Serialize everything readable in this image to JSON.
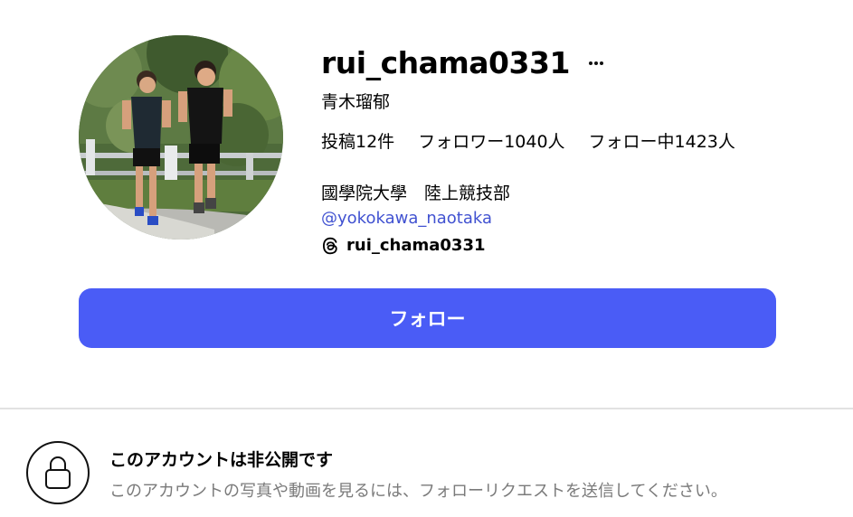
{
  "profile": {
    "username": "rui_chama0331",
    "more_icon": "more-horizontal-icon",
    "full_name": "青木瑠郁",
    "stats": {
      "posts": "投稿12件",
      "followers": "フォロワー1040人",
      "following": "フォロー中1423人"
    },
    "bio": "國學院大學　陸上競技部",
    "mention": "@yokokawa_naotaka",
    "threads_icon": "threads-icon",
    "threads_handle": "rui_chama0331"
  },
  "follow_button": {
    "label": "フォロー",
    "color": "#4a5cf6"
  },
  "private_notice": {
    "icon": "lock-icon",
    "title": "このアカウントは非公開です",
    "description": "このアカウントの写真や動画を見るには、フォローリクエストを送信してください。"
  },
  "colors": {
    "link": "#4152d1",
    "muted_text": "#7a7a7a",
    "divider": "#e2e2e2"
  }
}
